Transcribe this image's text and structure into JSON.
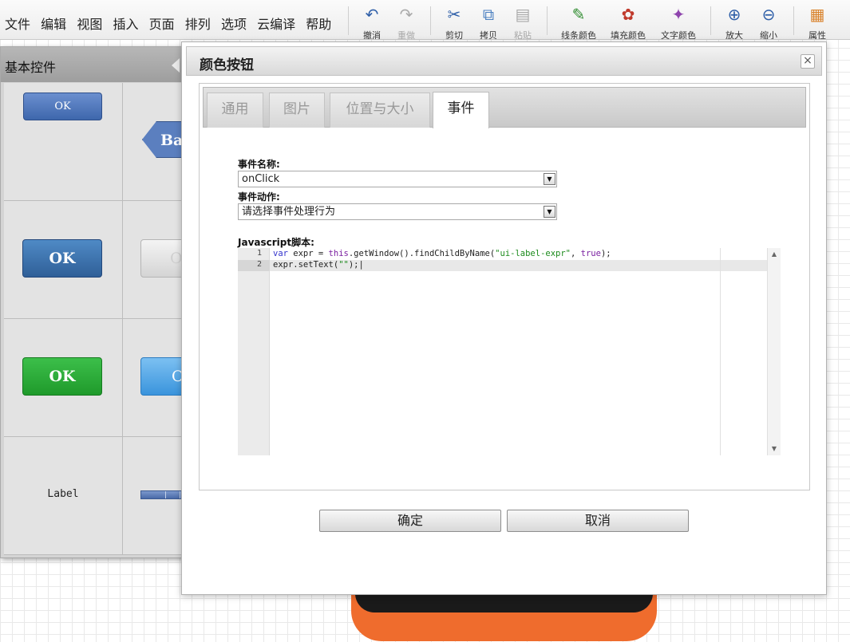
{
  "menu": [
    "文件",
    "编辑",
    "视图",
    "插入",
    "页面",
    "排列",
    "选项",
    "云编译",
    "帮助"
  ],
  "toolbar": {
    "undo": {
      "label": "撤消",
      "icon": "undo-icon"
    },
    "redo": {
      "label": "重做",
      "icon": "redo-icon"
    },
    "cut": {
      "label": "剪切",
      "icon": "scissors-icon"
    },
    "copy": {
      "label": "拷贝",
      "icon": "copy-icon"
    },
    "paste": {
      "label": "粘贴",
      "icon": "paste-icon"
    },
    "line_color": {
      "label": "线条颜色",
      "icon": "pencil-icon"
    },
    "fill_color": {
      "label": "填充颜色",
      "icon": "paint-bucket-icon"
    },
    "text_color": {
      "label": "文字颜色",
      "icon": "text-color-icon"
    },
    "zoom_in": {
      "label": "放大",
      "icon": "zoom-in-icon"
    },
    "zoom_out": {
      "label": "缩小",
      "icon": "zoom-out-icon"
    },
    "properties": {
      "label": "属性",
      "icon": "properties-icon"
    }
  },
  "palette": {
    "title": "基本控件",
    "widgets": {
      "ok_small": "OK",
      "back": "Ba",
      "ok_blue": "OK",
      "grey": "O",
      "ok_green": "OK",
      "blue": "O",
      "label": "Label"
    }
  },
  "dialog": {
    "title": "颜色按钮",
    "close_symbol": "×",
    "tabs": [
      "通用",
      "图片",
      "位置与大小",
      "事件"
    ],
    "active_tab": "事件",
    "event_name_label": "事件名称:",
    "event_name_value": "onClick",
    "event_action_label": "事件动作:",
    "event_action_value": "请选择事件处理行为",
    "script_label": "Javascript脚本:",
    "script_lines": [
      "var expr = this.getWindow().findChildByName(\"ui-label-expr\", true);",
      "expr.setText(\"\");"
    ],
    "ok_button": "确定",
    "cancel_button": "取消"
  },
  "colors": {
    "accent_blue": "#3e67ac",
    "accent_green": "#1f9a2b",
    "shape_orange": "#ef6c2d"
  }
}
